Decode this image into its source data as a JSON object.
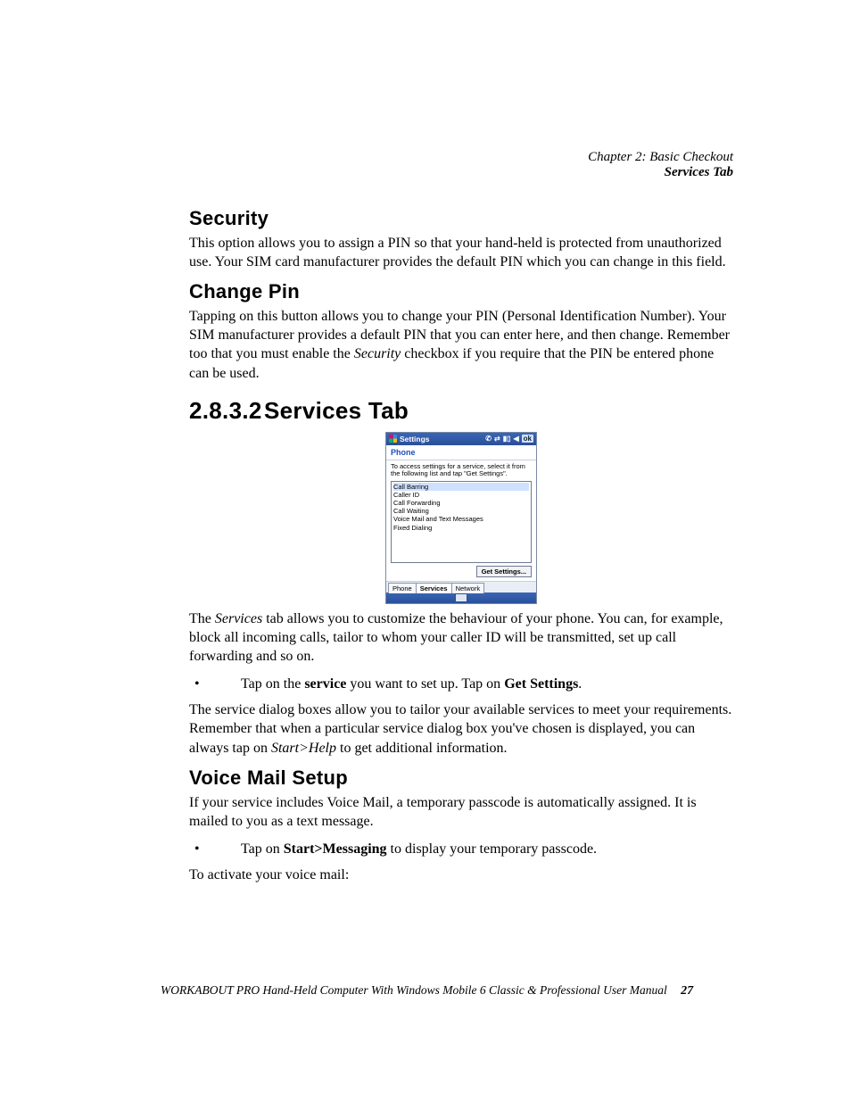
{
  "header": {
    "chapter": "Chapter 2:  Basic Checkout",
    "section": "Services Tab"
  },
  "security": {
    "heading": "Security",
    "p1": "This option allows you to assign a PIN so that your hand-held is protected from unauthorized use. Your SIM card manufacturer provides the default PIN which you can change in this field."
  },
  "changepin": {
    "heading": "Change Pin",
    "p1a": "Tapping on this button allows you to change your PIN (Personal Identification Number). Your SIM manufacturer provides a default PIN that you can enter here, and then change. Remember too that you must enable the ",
    "p1_em": "Security",
    "p1b": " checkbox if you require that the PIN be entered phone can be used."
  },
  "servicestab": {
    "num": "2.8.3.2",
    "title": "Services Tab",
    "p1a": "The ",
    "p1_em": "Services",
    "p1b": " tab allows you to customize the behaviour of your phone. You can, for example, block all incoming calls, tailor to whom your caller ID will be transmitted, set up call forwarding and so on.",
    "bullet1_a": "Tap on the ",
    "bullet1_b1": "service",
    "bullet1_c": " you want to set up. Tap on ",
    "bullet1_b2": "Get Settings",
    "bullet1_d": ".",
    "p2a": "The service dialog boxes allow you to tailor your available services to meet your requirements. Remember that when a particular service dialog box you've chosen is displayed, you can always tap on ",
    "p2_em": "Start>Help",
    "p2b": " to get additional information."
  },
  "voicemail": {
    "heading": "Voice Mail Setup",
    "p1": "If your service includes Voice Mail, a temporary passcode is automatically assigned. It is mailed to you as a text message.",
    "bullet1_a": "Tap on ",
    "bullet1_b": "Start>Messaging",
    "bullet1_c": " to display your temporary passcode.",
    "p2": "To activate your voice mail:"
  },
  "screenshot": {
    "titlebar": "Settings",
    "ok": "ok",
    "subtitle": "Phone",
    "instruction": "To access settings for a service, select it from the following list and tap \"Get Settings\".",
    "items": [
      "Call Barring",
      "Caller ID",
      "Call Forwarding",
      "Call Waiting",
      "Voice Mail and Text Messages",
      "Fixed Dialing"
    ],
    "button": "Get Settings...",
    "tabs": [
      "Phone",
      "Services",
      "Network"
    ]
  },
  "footer": {
    "text": "WORKABOUT PRO Hand-Held Computer With Windows Mobile 6 Classic & Professional User Manual",
    "page": "27"
  }
}
